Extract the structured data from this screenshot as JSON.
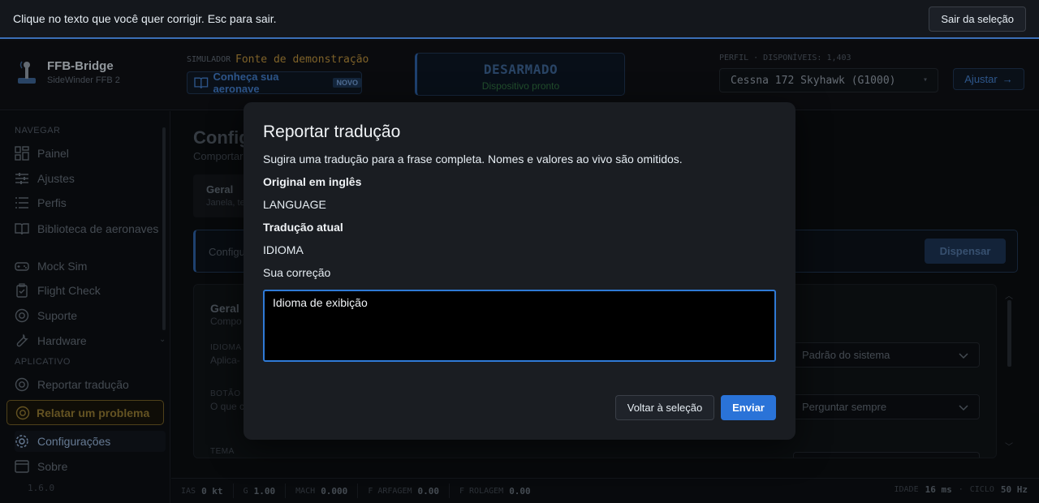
{
  "banner": {
    "instruction": "Clique no texto que você quer corrigir. Esc para sair.",
    "exit_label": "Sair da seleção"
  },
  "header": {
    "app_name": "FFB-Bridge",
    "device_name": "SideWinder FFB 2",
    "simulator_label": "SIMULADOR",
    "simulator_value": "Fonte de demonstração",
    "aircraft_link": "Conheça sua aeronave",
    "new_badge": "NOVO",
    "arm_status": "DESARMADO",
    "device_status": "Dispositivo pronto",
    "profile_label": "PERFIL · DISPONÍVEIS: 1,403",
    "profile_value": "Cessna 172 Skyhawk (G1000)",
    "adjust_label": "Ajustar"
  },
  "sidebar": {
    "nav_section": "NAVEGAR",
    "items": [
      {
        "label": "Painel"
      },
      {
        "label": "Ajustes"
      },
      {
        "label": "Perfis"
      },
      {
        "label": "Biblioteca de aeronaves"
      },
      {
        "label": "Mock Sim"
      },
      {
        "label": "Flight Check"
      },
      {
        "label": "Suporte"
      },
      {
        "label": "Hardware"
      }
    ],
    "app_section": "APLICATIVO",
    "app_items": [
      {
        "label": "Reportar tradução"
      },
      {
        "label": "Relatar um problema"
      },
      {
        "label": "Configurações"
      },
      {
        "label": "Sobre"
      }
    ],
    "version": "1.6.0"
  },
  "main": {
    "title": "Config",
    "subtitle": "Comportar",
    "tab": {
      "title": "Geral",
      "subtitle": "Janela, te"
    },
    "notice": {
      "text": "Configu",
      "dismiss_label": "Dispensar"
    },
    "card": {
      "title": "Geral",
      "subtitle": "Compo",
      "language_label": "IDIOMA",
      "language_desc": "Aplica-",
      "language_value": "Padrão do sistema",
      "button_label": "BOTÃO",
      "button_desc": "O que c",
      "button_value": "Perguntar sempre",
      "theme_label": "TEMA"
    }
  },
  "statusbar": {
    "items": [
      {
        "label": "IAS",
        "value": "0 kt"
      },
      {
        "label": "G",
        "value": "1.00"
      },
      {
        "label": "MACH",
        "value": "0.000"
      },
      {
        "label": "F ARFAGEM",
        "value": "0.00"
      },
      {
        "label": "F ROLAGEM",
        "value": "0.00"
      }
    ],
    "latency_label": "IDADE",
    "latency_value": "16 ms",
    "cycle_label": "CICLO",
    "cycle_value": "50 Hz"
  },
  "modal": {
    "title": "Reportar tradução",
    "description": "Sugira uma tradução para a frase completa. Nomes e valores ao vivo são omitidos.",
    "original_heading": "Original em inglês",
    "original_value": "LANGUAGE",
    "current_heading": "Tradução atual",
    "current_value": "IDIOMA",
    "correction_heading": "Sua correção",
    "correction_value": "Idioma de exibição",
    "back_label": "Voltar à seleção",
    "send_label": "Enviar"
  },
  "colors": {
    "accent": "#2a73d8",
    "warning": "#8b7330",
    "background": "#0b0d10",
    "modal": "#1a1d22"
  }
}
